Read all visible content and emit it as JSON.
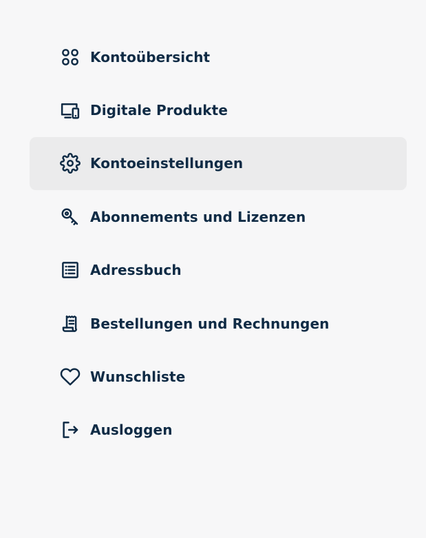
{
  "menu": {
    "items": [
      {
        "label": "Kontoübersicht",
        "icon": "grid-icon",
        "active": false
      },
      {
        "label": "Digitale Produkte",
        "icon": "devices-icon",
        "active": false
      },
      {
        "label": "Kontoeinstellungen",
        "icon": "gear-icon",
        "active": true
      },
      {
        "label": "Abonnements und Lizenzen",
        "icon": "key-icon",
        "active": false
      },
      {
        "label": "Adressbuch",
        "icon": "list-icon",
        "active": false
      },
      {
        "label": "Bestellungen und Rechnungen",
        "icon": "receipt-icon",
        "active": false
      },
      {
        "label": "Wunschliste",
        "icon": "heart-icon",
        "active": false
      },
      {
        "label": "Ausloggen",
        "icon": "logout-icon",
        "active": false
      }
    ]
  },
  "colors": {
    "text": "#0f2b45",
    "background": "#f7f7f8",
    "active_background": "#ebebec"
  }
}
